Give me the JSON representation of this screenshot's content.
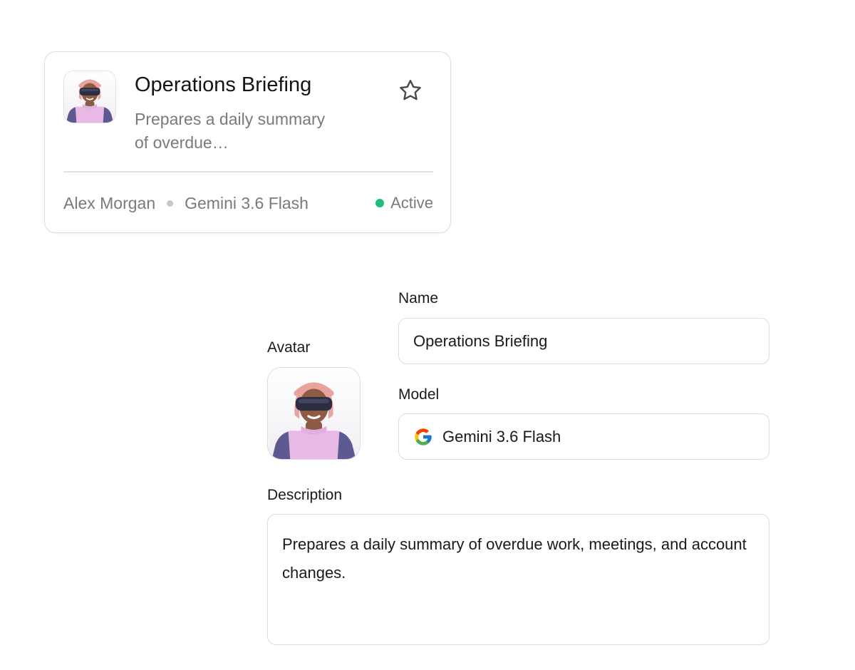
{
  "agent_card": {
    "title": "Operations Briefing",
    "description": "Prepares a daily summary of overdue…",
    "owner": "Alex Morgan",
    "model": "Gemini 3.6 Flash",
    "status": "Active",
    "status_color": "#1dbf7e",
    "favorite_icon": "star-outline-icon",
    "avatar_icon": "vr-headset-person-avatar"
  },
  "form": {
    "avatar_label": "Avatar",
    "name_label": "Name",
    "name_value": "Operations Briefing",
    "model_label": "Model",
    "model_value": "Gemini 3.6 Flash",
    "model_icon": "google-g-icon",
    "description_label": "Description",
    "description_value": "Prepares a daily summary of overdue work, meetings, and account changes."
  }
}
